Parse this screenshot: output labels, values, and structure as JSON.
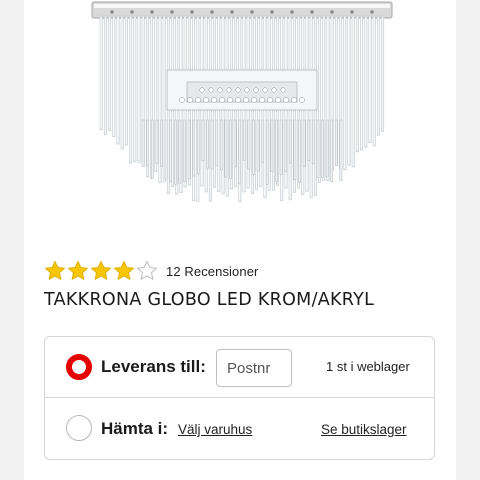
{
  "product": {
    "image_alt": "Chandelier with glass rods",
    "rating": {
      "value": 4,
      "max": 5,
      "reviews_label": "12 Recensioner"
    },
    "title": "TAKKRONA GLOBO LED KROM/AKRYL"
  },
  "delivery": {
    "label": "Leverans till:",
    "postal_placeholder": "Postnr",
    "stock": "1 st i weblager",
    "selected": true
  },
  "pickup": {
    "label": "Hämta i:",
    "store_link": "Välj varuhus",
    "stock_link": "Se butikslager",
    "selected": false
  },
  "colors": {
    "accent_red": "#e60000",
    "star_gold": "#f7c600",
    "text": "#1a1a1a",
    "border": "#d6d6d6"
  }
}
